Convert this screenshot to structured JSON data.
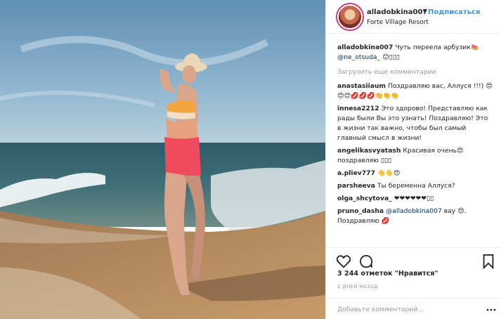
{
  "post": {
    "photo_icon": "beach-photo"
  },
  "header": {
    "username": "alladobkina007",
    "separator": "•",
    "follow_label": "Подписаться",
    "location": "Forte Village Resort"
  },
  "caption": {
    "username": "alladobkina007",
    "text": "Чуть переела арбузик🍉",
    "mention": "@ne_otsuda_",
    "tail": "😊▯▯▯"
  },
  "load_more_label": "Загрузить еще комментарии",
  "comments": [
    {
      "username": "anastasiiaum",
      "text": "Поздравляю вас, Аллуся !!!) 😍😍😍💋💋💋👏👏👏"
    },
    {
      "username": "innesa2212",
      "text": "Это здорово! Представляю как рады были Вы это узнать! Поздравляю! Это в жизни так важно, чтобы был самый главный смысл в жизни!"
    },
    {
      "username": "angelikasvyatash",
      "text": "Красивая очень😍 поздравляю ▯▯▯"
    },
    {
      "username": "a.pliev777",
      "text": "👋👋😍"
    },
    {
      "username": "parsheeva",
      "text": "Ты беременна Аллуся?"
    },
    {
      "username": "olga_shcytova_",
      "text": "❤❤❤❤❤❤▯▯"
    },
    {
      "username": "pruno_dasha",
      "mention": "@alladobkina007",
      "text": "вау 😍. Поздравляю 💋"
    }
  ],
  "actions": {
    "like_icon": "heart-icon",
    "comment_icon": "comment-icon",
    "save_icon": "bookmark-icon"
  },
  "likes_label": "3 244 отметок \"Нравится\"",
  "timestamp": "2 ДНЕЙ НАЗАД",
  "add_comment": {
    "placeholder": "Добавьте комментарий...",
    "more_icon": "more-dots-icon"
  },
  "colors": {
    "link_blue": "#3897f0",
    "mention_blue": "#003569",
    "muted_gray": "#999999"
  }
}
